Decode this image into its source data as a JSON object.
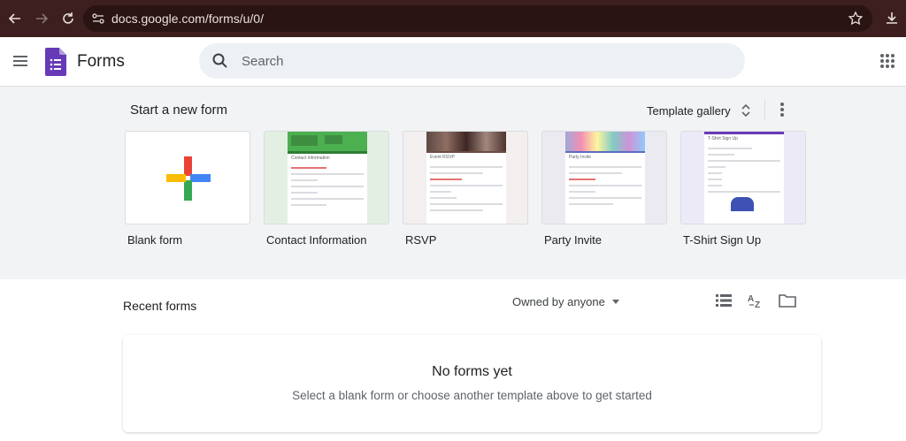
{
  "browser": {
    "url": "docs.google.com/forms/u/0/",
    "chrome_color": "#3c1f1e"
  },
  "header": {
    "app_title": "Forms",
    "search_placeholder": "Search"
  },
  "templates": {
    "section_title": "Start a new form",
    "gallery_label": "Template gallery",
    "items": [
      {
        "label": "Blank form"
      },
      {
        "label": "Contact Information",
        "thumb_title": "Contact Information"
      },
      {
        "label": "RSVP",
        "thumb_title": "Event RSVP"
      },
      {
        "label": "Party Invite",
        "thumb_title": "Party Invite"
      },
      {
        "label": "T-Shirt Sign Up",
        "thumb_title": "T-Shirt Sign Up"
      }
    ]
  },
  "recent": {
    "title": "Recent forms",
    "owner_filter": "Owned by anyone",
    "empty_title": "No forms yet",
    "empty_subtitle": "Select a blank form or choose another template above to get started"
  },
  "colors": {
    "forms_purple": "#673ab7",
    "google_red": "#ea4335",
    "google_blue": "#4285f4",
    "google_green": "#34a853",
    "google_yellow": "#fbbc04"
  }
}
